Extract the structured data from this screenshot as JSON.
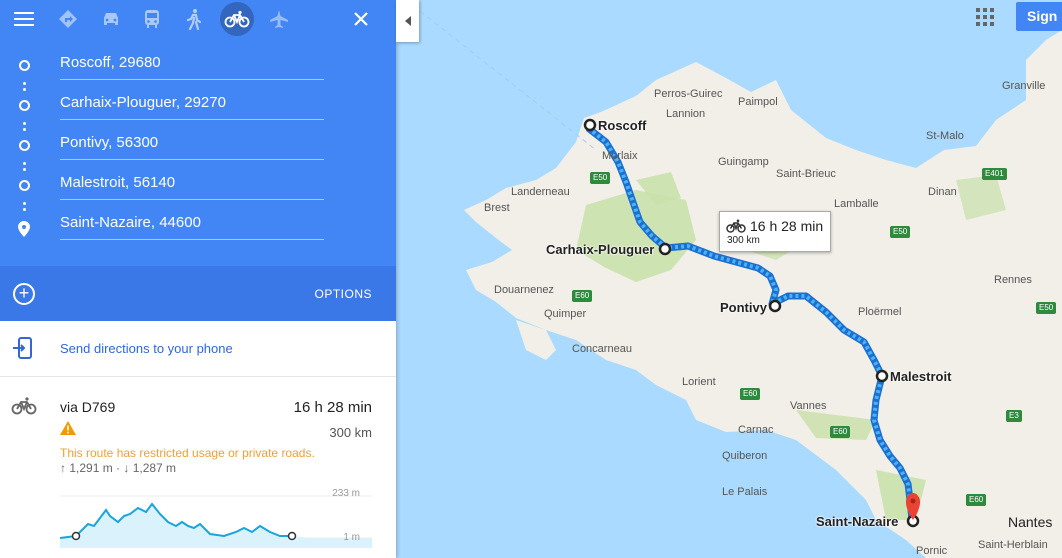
{
  "modes": [
    {
      "name": "directions-mode-button",
      "icon": "directions-icon",
      "active": false
    },
    {
      "name": "car-mode-button",
      "icon": "car-icon",
      "active": false
    },
    {
      "name": "transit-mode-button",
      "icon": "transit-icon",
      "active": false
    },
    {
      "name": "walk-mode-button",
      "icon": "walk-icon",
      "active": false
    },
    {
      "name": "bike-mode-button",
      "icon": "bike-icon",
      "active": true
    },
    {
      "name": "flight-mode-button",
      "icon": "flight-icon",
      "active": false
    }
  ],
  "stops": [
    {
      "value": "Roscoff, 29680"
    },
    {
      "value": "Carhaix-Plouguer, 29270"
    },
    {
      "value": "Pontivy, 56300"
    },
    {
      "value": "Malestroit, 56140"
    },
    {
      "value": "Saint-Nazaire, 44600"
    }
  ],
  "options_label": "OPTIONS",
  "add_symbol": "+",
  "send_label": "Send directions to your phone",
  "route": {
    "via": "via D769",
    "time": "16 h 28 min",
    "distance": "300 km",
    "warning": "This route has restricted usage or private roads.",
    "elevation": "↑ 1,291 m · ↓ 1,287 m",
    "elev_max": "233 m",
    "elev_min": "1 m"
  },
  "map": {
    "info_time": "16 h 28 min",
    "info_dist": "300 km",
    "signin": "Sign in",
    "waypoints": [
      "Roscoff",
      "Carhaix-Plouguer",
      "Pontivy",
      "Malestroit",
      "Saint-Nazaire"
    ],
    "places": [
      "Perros-Guirec",
      "Lannion",
      "Paimpol",
      "Morlaix",
      "Guingamp",
      "Saint-Brieuc",
      "Landerneau",
      "Brest",
      "Lamballe",
      "Dinan",
      "St-Malo",
      "Granville",
      "Douarnenez",
      "Quimper",
      "Concarneau",
      "Lorient",
      "Ploërmel",
      "Rennes",
      "Vannes",
      "Carnac",
      "Quiberon",
      "Le Palais",
      "Pornic",
      "Nantes",
      "Saint-Herblain"
    ],
    "roads": [
      "E50",
      "E50",
      "E60",
      "E60",
      "E60",
      "E60",
      "E401",
      "E3",
      "E50"
    ],
    "colors": {
      "water": "#aadaff",
      "land": "#f2efe9",
      "forest": "#c8e0a8",
      "route": "#4ab3f5",
      "panel": "#4285f4"
    }
  }
}
